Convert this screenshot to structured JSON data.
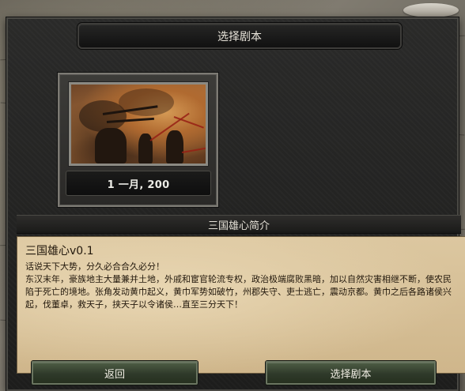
{
  "dialog": {
    "title": "选择剧本"
  },
  "scenario": {
    "date": "1 一月, 200"
  },
  "description": {
    "header": "三国雄心简介",
    "title": "三国雄心v0.1",
    "body": "话说天下大势，分久必合合久必分！\n东汉末年，豪族地主大量兼并土地，外戚和宦官轮流专权，政治极端腐败黑暗，加以自然灾害相继不断，使农民陷于死亡的境地。张角发动黄巾起义，黄巾军势如破竹，州郡失守、吏士逃亡，震动京都。黄巾之后各路诸侯兴起，伐董卓，救天子，挟天子以令诸侯…直至三分天下！"
  },
  "buttons": {
    "back": "返回",
    "select": "选择剧本"
  }
}
